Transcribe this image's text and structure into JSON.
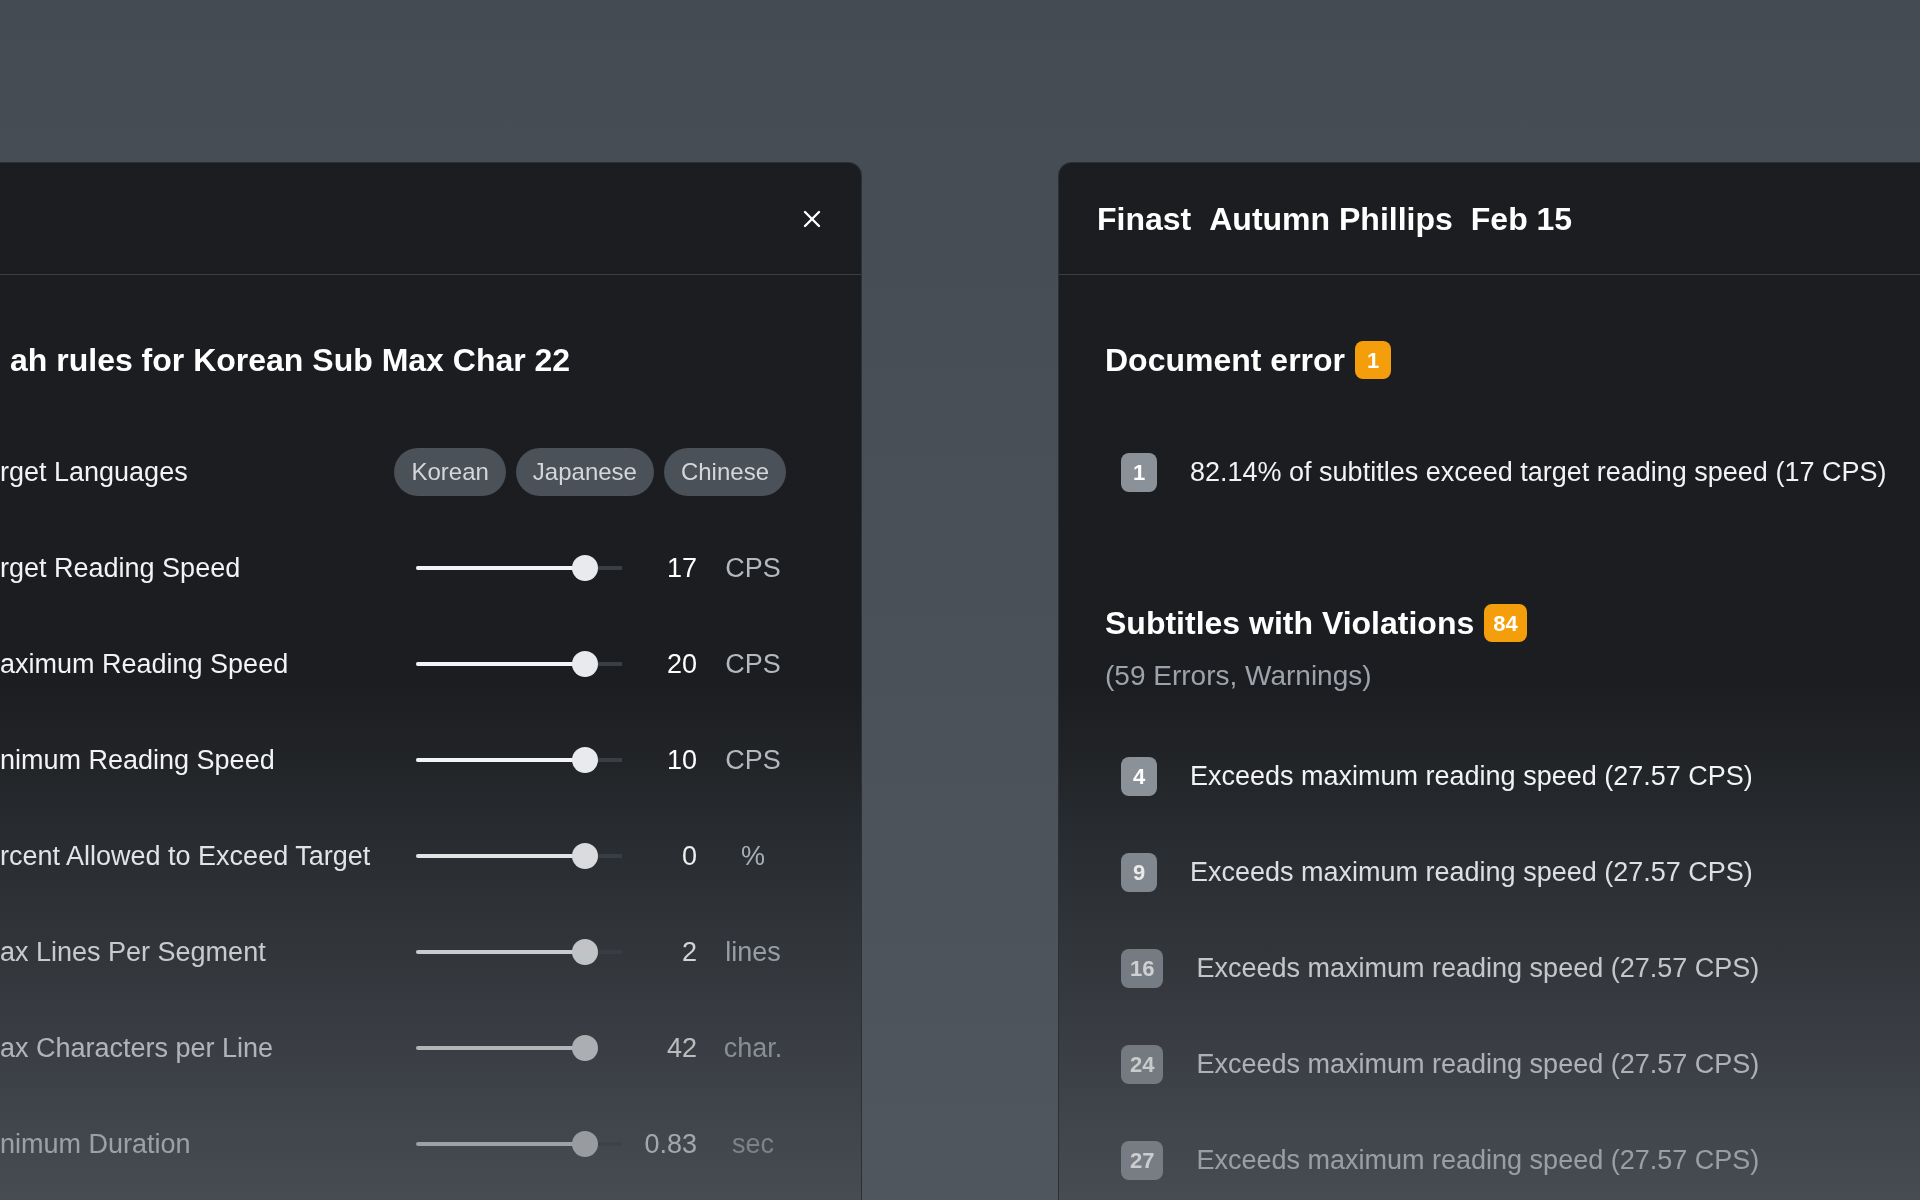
{
  "settings_panel": {
    "title": "ah rules for Korean Sub Max Char 22",
    "languages_label": "rget Languages",
    "languages": [
      "Korean",
      "Japanese",
      "Chinese"
    ],
    "sliders": [
      {
        "label": "rget Reading Speed",
        "level": 0.82,
        "value": "17",
        "unit": "CPS"
      },
      {
        "label": "aximum Reading Speed",
        "level": 0.82,
        "value": "20",
        "unit": "CPS"
      },
      {
        "label": "nimum Reading Speed",
        "level": 0.82,
        "value": "10",
        "unit": "CPS"
      },
      {
        "label": "rcent Allowed to Exceed Target",
        "level": 0.82,
        "value": "0",
        "unit": "%"
      },
      {
        "label": "ax Lines Per Segment",
        "level": 0.82,
        "value": "2",
        "unit": "lines"
      },
      {
        "label": "ax Characters per Line",
        "level": 0.82,
        "value": "42",
        "unit": "char."
      },
      {
        "label": "nimum Duration",
        "level": 0.82,
        "value": "0.83",
        "unit": "sec"
      }
    ]
  },
  "report_panel": {
    "header_items": [
      "Finast",
      "Autumn Phillips",
      "Feb 15"
    ],
    "document_error": {
      "title": "Document error",
      "count": "1",
      "items": [
        {
          "number": "1",
          "text": "82.14% of subtitles exceed target reading speed (17 CPS)"
        }
      ]
    },
    "violations": {
      "title": "Subtitles with Violations",
      "count": "84",
      "summary": "(59 Errors, Warnings)",
      "items": [
        {
          "number": "4",
          "text": "Exceeds maximum reading speed (27.57 CPS)"
        },
        {
          "number": "9",
          "text": "Exceeds maximum reading speed (27.57 CPS)"
        },
        {
          "number": "16",
          "text": "Exceeds maximum reading speed (27.57 CPS)"
        },
        {
          "number": "24",
          "text": "Exceeds maximum reading speed (27.57 CPS)"
        },
        {
          "number": "27",
          "text": "Exceeds maximum reading speed (27.57 CPS)"
        }
      ]
    }
  }
}
